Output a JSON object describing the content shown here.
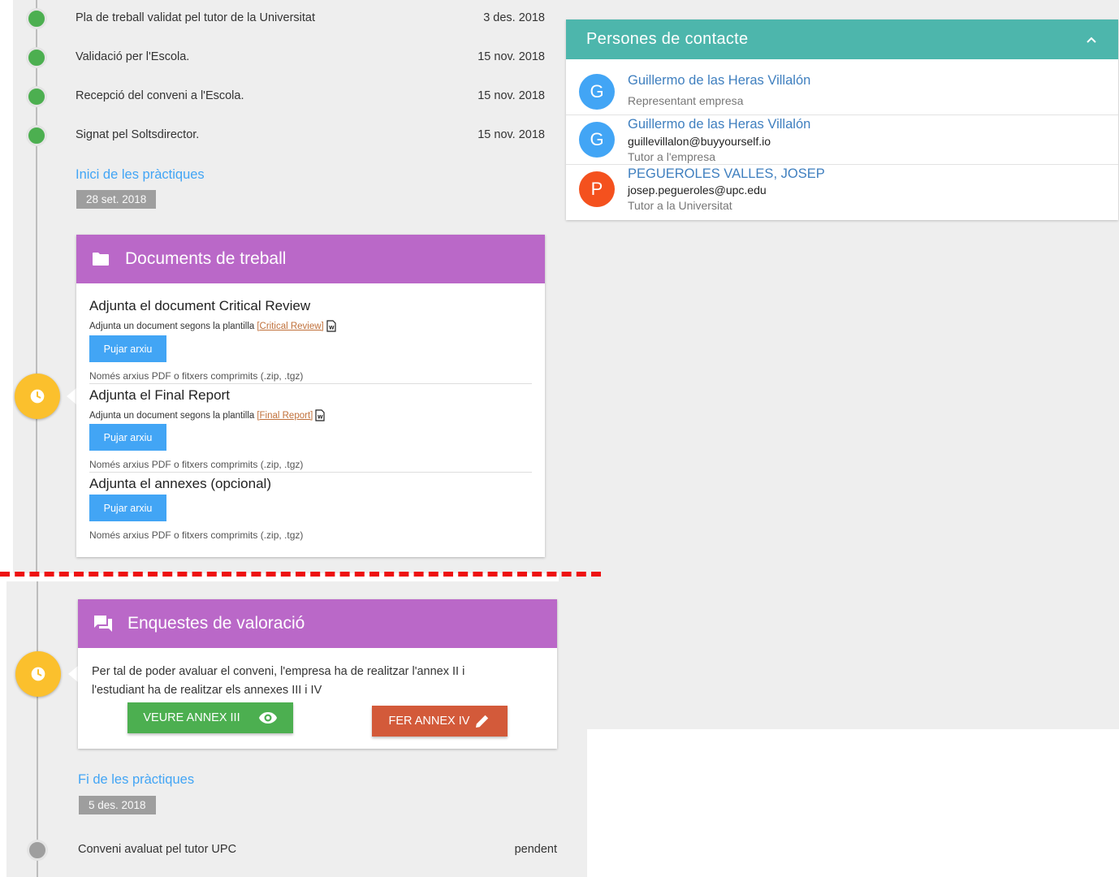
{
  "timeline_top": [
    {
      "text": "Pla de treball validat pel tutor de la Universitat",
      "date": "3 des. 2018"
    },
    {
      "text": "Validació per l'Escola.",
      "date": "15 nov. 2018"
    },
    {
      "text": "Recepció del conveni a l'Escola.",
      "date": "15 nov. 2018"
    },
    {
      "text": "Signat pel Soltsdirector.",
      "date": "15 nov. 2018"
    }
  ],
  "start_section": {
    "title": "Inici de les pràctiques",
    "date": "28 set. 2018"
  },
  "documents_card": {
    "title": "Documents de treball",
    "icon": "folder-icon",
    "items": [
      {
        "title": "Adjunta el document Critical Review",
        "subtitle": "Adjunta un document segons la plantilla",
        "template_link": "[Critical Review]",
        "button": "Pujar arxiu",
        "hint": "Només arxius PDF o fitxers comprimits (.zip, .tgz)"
      },
      {
        "title": "Adjunta el Final Report",
        "subtitle": "Adjunta un document segons la plantilla",
        "template_link": "[Final Report]",
        "button": "Pujar arxiu",
        "hint": "Només arxius PDF o fitxers comprimits (.zip, .tgz)"
      },
      {
        "title": "Adjunta el annexes (opcional)",
        "button": "Pujar arxiu",
        "hint": "Només arxius PDF o fitxers comprimits (.zip, .tgz)"
      }
    ]
  },
  "survey_card": {
    "title": "Enquestes de valoració",
    "icon": "chat-icon",
    "text": "Per tal de poder avaluar el conveni, l'empresa ha de realitzar l'annex II i l'estudiant ha de realitzar els annexes III i IV",
    "view_button": "VEURE ANNEX III",
    "edit_button": "FER ANNEX IV"
  },
  "end_section": {
    "title": "Fi de les pràctiques",
    "date": "5 des. 2018"
  },
  "timeline_bottom": [
    {
      "text": "Conveni avaluat pel tutor UPC",
      "status": "pendent"
    }
  ],
  "contacts": {
    "title": "Persones de contacte",
    "items": [
      {
        "initial": "G",
        "name": "Guillermo de las Heras Villalón",
        "email": "",
        "role": "Representant empresa",
        "color": "#42a5f5"
      },
      {
        "initial": "G",
        "name": "Guillermo de las Heras Villalón",
        "email": "guillevillalon@buyyourself.io",
        "role": "Tutor a l'empresa",
        "color": "#42a5f5"
      },
      {
        "initial": "P",
        "name": "PEGUEROLES VALLES, JOSEP",
        "email": "josep.pegueroles@upc.edu",
        "role": "Tutor a la Universitat",
        "color": "#f4511e"
      }
    ]
  },
  "colors": {
    "accent_purple": "#ba68c8",
    "accent_teal": "#4db6ac",
    "success_green": "#4caf50",
    "warning_yellow": "#fbc02d",
    "link_blue": "#42a5f5"
  }
}
